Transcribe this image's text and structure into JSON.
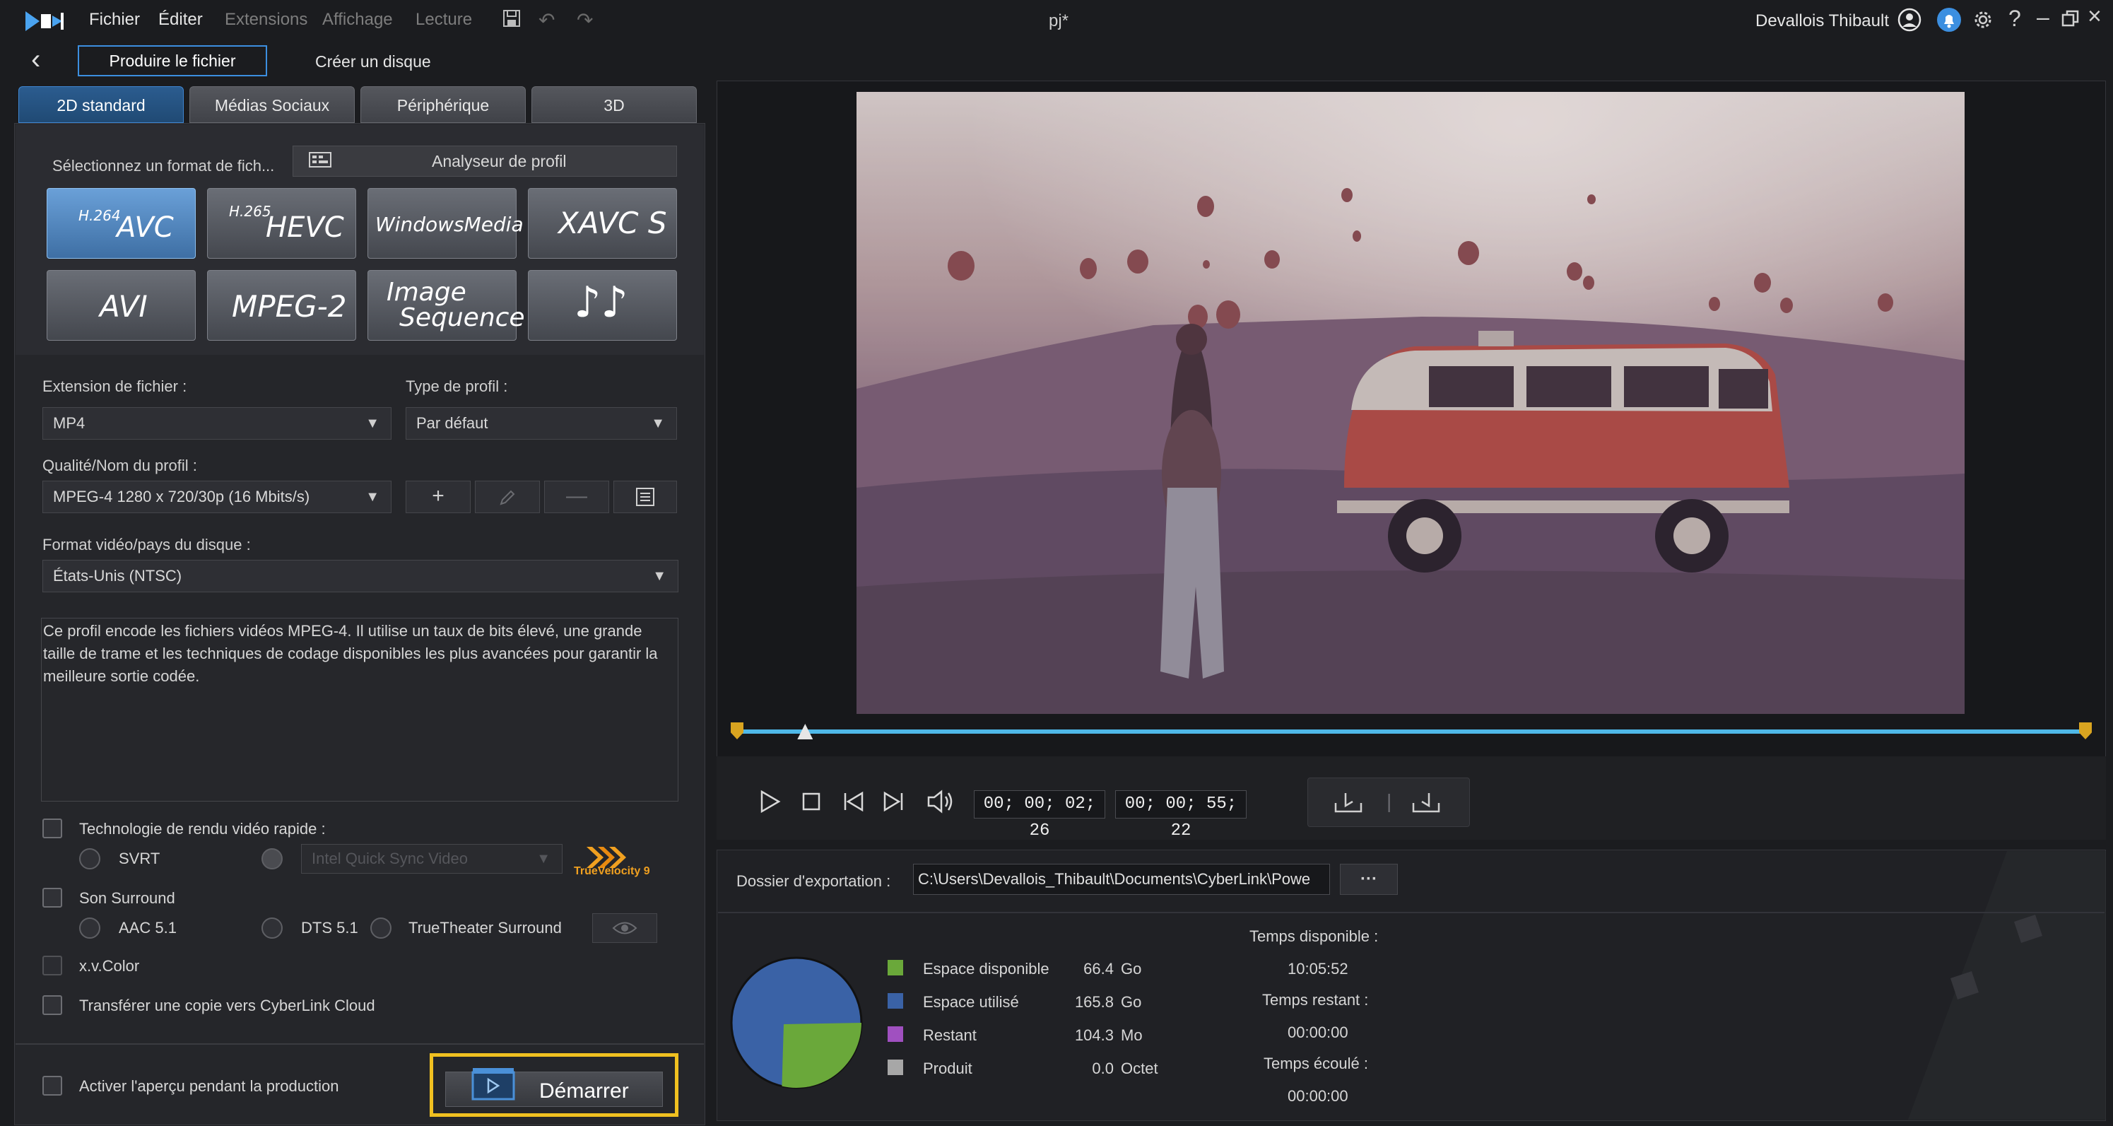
{
  "app": {
    "title": "pj*",
    "user": "Devallois Thibault"
  },
  "menu": {
    "file": "Fichier",
    "edit": "Éditer",
    "extensions": "Extensions",
    "view": "Affichage",
    "playback": "Lecture"
  },
  "subnav": {
    "produce": "Produire le fichier",
    "disc": "Créer un disque"
  },
  "tabs": [
    "2D standard",
    "Médias Sociaux",
    "Périphérique",
    "3D"
  ],
  "format": {
    "select_label": "Sélectionnez un format de fich...",
    "profile_analyzer": "Analyseur de profil",
    "buttons": {
      "avc_sup": "H.264",
      "avc": "AVC",
      "hevc_sup": "H.265",
      "hevc": "HEVC",
      "wmv": "WindowsMedia",
      "xavc": "XAVC S",
      "avi": "AVI",
      "mpeg2": "MPEG-2",
      "imgseq1": "Image",
      "imgseq2": "Sequence",
      "audio": "♪♪"
    }
  },
  "settings": {
    "ext_label": "Extension de fichier :",
    "ext_value": "MP4",
    "ptype_label": "Type de profil :",
    "ptype_value": "Par défaut",
    "quality_label": "Qualité/Nom du profil :",
    "quality_value": "MPEG-4 1280 x 720/30p (16 Mbits/s)",
    "disc_label": "Format vidéo/pays du disque :",
    "disc_value": "États-Unis (NTSC)",
    "description": "Ce profil encode les fichiers vidéos MPEG-4.  Il utilise un taux de bits élevé, une grande taille de trame et les techniques de codage disponibles les plus avancées pour garantir la meilleure sortie codée."
  },
  "options": {
    "fast_render": "Technologie de rendu vidéo rapide :",
    "svrt": "SVRT",
    "intel": "Intel Quick Sync Video",
    "truevelocity": "TrueVelocity 9",
    "surround": "Son Surround",
    "aac": "AAC 5.1",
    "dts": "DTS 5.1",
    "truetheater": "TrueTheater Surround",
    "xvcolor": "x.v.Color",
    "cloud": "Transférer une copie vers CyberLink Cloud",
    "preview": "Activer l'aperçu pendant la production",
    "start": "Démarrer"
  },
  "player": {
    "current_time": "00; 00; 02; 26",
    "duration": "00; 00; 55; 22",
    "progress": 0.05
  },
  "export": {
    "folder_label": "Dossier d'exportation :",
    "folder_path": "C:\\Users\\Devallois_Thibault\\Documents\\CyberLink\\Powe",
    "more": "···",
    "legend": [
      {
        "label": "Espace disponible",
        "value": "66.4",
        "unit": "Go",
        "color": "#6aa83a"
      },
      {
        "label": "Espace utilisé",
        "value": "165.8",
        "unit": "Go",
        "color": "#3a62a6"
      },
      {
        "label": "Restant",
        "value": "104.3",
        "unit": "Mo",
        "color": "#a050c0"
      },
      {
        "label": "Produit",
        "value": "0.0",
        "unit": "Octet",
        "color": "#a7a7a7"
      }
    ],
    "time_available_label": "Temps disponible :",
    "time_available": "10:05:52",
    "time_remaining_label": "Temps restant :",
    "time_remaining": "00:00:00",
    "time_elapsed_label": "Temps écoulé :",
    "time_elapsed": "00:00:00"
  },
  "colors": {
    "accent": "#3c8fe0",
    "highlight": "#f0c020",
    "timeline": "#4fb8e8"
  }
}
